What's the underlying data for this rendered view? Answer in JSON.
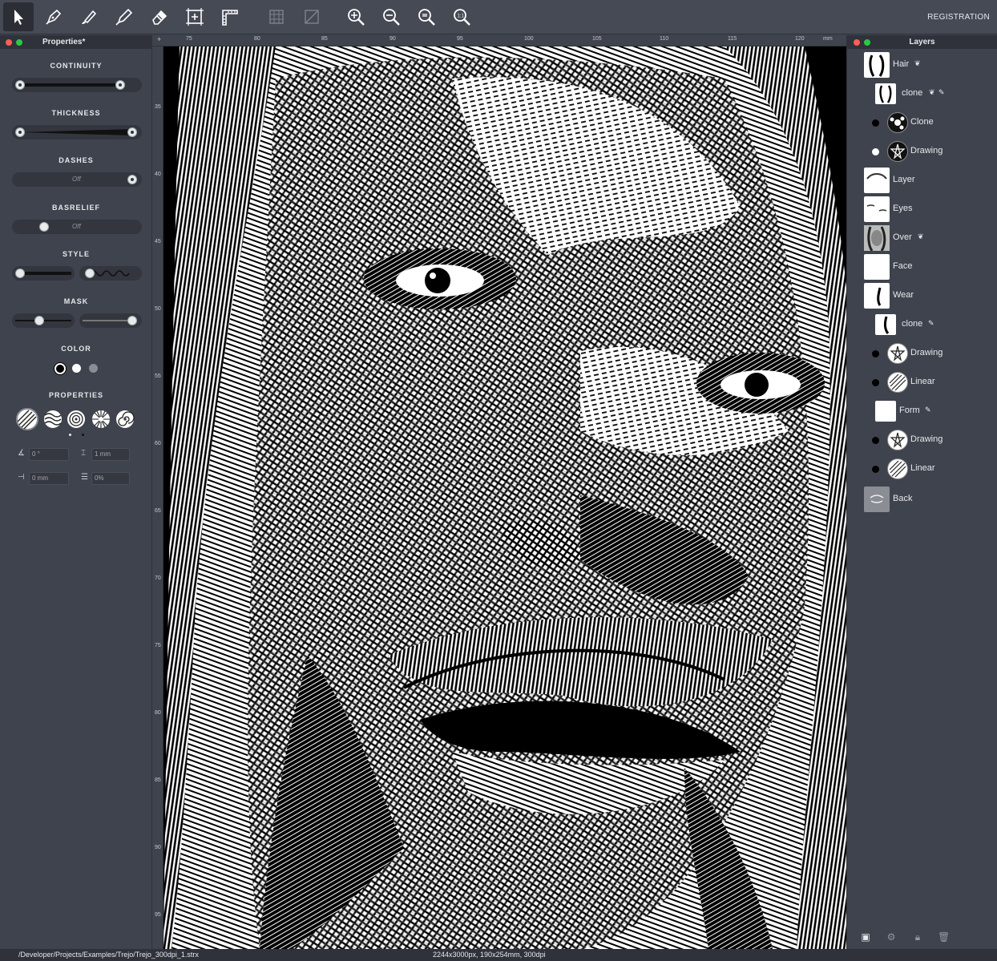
{
  "toolbar": {
    "registration_label": "REGISTRATION",
    "tools": [
      "select-arrow-icon",
      "pen-tool-icon",
      "brush-icon",
      "pencil-icon",
      "eraser-icon",
      "frame-tool-icon",
      "ruler-icon",
      "grid-icon",
      "transform-icon",
      "zoom-in-icon",
      "zoom-out-icon",
      "zoom-fit-icon",
      "zoom-actual-icon"
    ]
  },
  "properties": {
    "title": "Properties*",
    "continuity": "CONTINUITY",
    "thickness": "THICKNESS",
    "dashes": "DASHES",
    "dashes_value": "Off",
    "basrelief": "BASRELIEF",
    "basrelief_value": "Off",
    "style": "STYLE",
    "mask": "MASK",
    "color": "COLOR",
    "properties": "PROPERTIES",
    "angle": "0 °",
    "interval": "1 mm",
    "offset": "0 mm",
    "percent": "0%"
  },
  "ruler": {
    "top": [
      "75",
      "80",
      "85",
      "90",
      "95",
      "100",
      "105",
      "110",
      "115",
      "120",
      "mm"
    ],
    "left": [
      "35",
      "40",
      "45",
      "50",
      "55",
      "60",
      "65",
      "70",
      "75",
      "80",
      "85",
      "90",
      "95"
    ]
  },
  "layers": {
    "title": "Layers",
    "items": [
      {
        "label": "Hair",
        "badge": "mask"
      },
      {
        "label": "clone",
        "badge": "mask pin"
      },
      {
        "label": "Clone"
      },
      {
        "label": "Drawing"
      },
      {
        "label": "Layer"
      },
      {
        "label": "Eyes"
      },
      {
        "label": "Over",
        "badge": "mask"
      },
      {
        "label": "Face"
      },
      {
        "label": "Wear"
      },
      {
        "label": "clone",
        "badge": "pin"
      },
      {
        "label": "Drawing"
      },
      {
        "label": "Linear"
      },
      {
        "label": "Form",
        "badge": "pin"
      },
      {
        "label": "Drawing"
      },
      {
        "label": "Linear"
      },
      {
        "label": "Back"
      }
    ]
  },
  "status": {
    "path": "/Developer/Projects/Examples/Trejo/Trejo_300dpi_1.strx",
    "info": "2244x3000px, 190x254mm, 300dpi"
  },
  "colors": {
    "panel_bg": "#3f434d",
    "header_bg": "#2f323a",
    "close_red": "#fc5d57",
    "zoom_green": "#2ac940"
  }
}
